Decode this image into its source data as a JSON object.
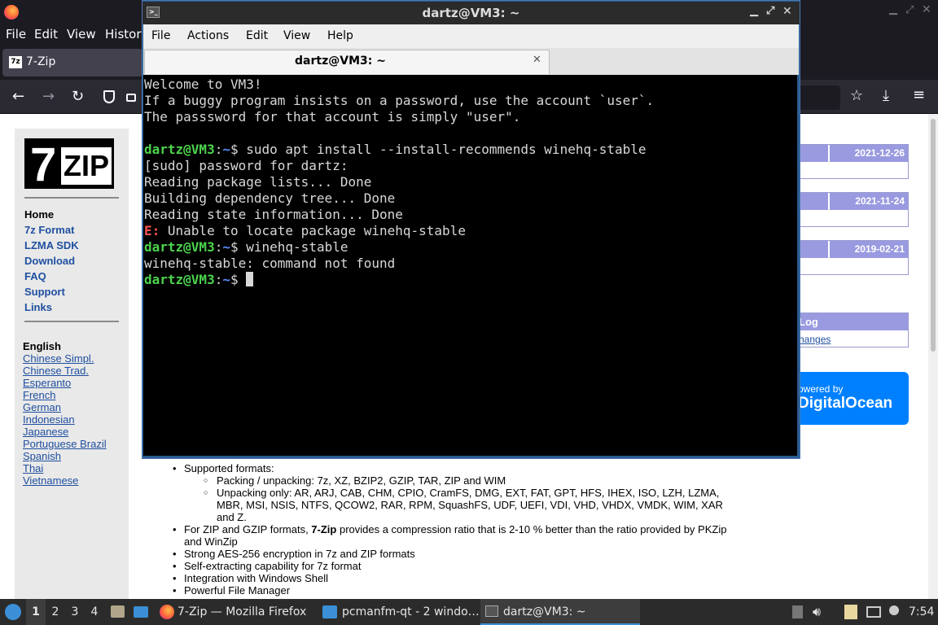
{
  "firefox": {
    "menu": [
      "File",
      "Edit",
      "View",
      "History"
    ],
    "tab_title": "7-Zip",
    "tab_icon_text": "7z"
  },
  "website": {
    "logo": {
      "seven": "7",
      "zip": "ZIP"
    },
    "nav": [
      "Home",
      "7z Format",
      "LZMA SDK",
      "Download",
      "FAQ",
      "Support",
      "Links"
    ],
    "language_heading": "English",
    "languages": [
      "Chinese Simpl.",
      "Chinese Trad.",
      "Esperanto",
      "French",
      "German",
      "Indonesian",
      "Japanese",
      "Portuguese Brazil",
      "Spanish",
      "Thai",
      "Vietnamese"
    ],
    "news_dates": [
      "2021-12-26",
      "2021-11-24",
      "2019-02-21"
    ],
    "log_heading": "Log",
    "log_link": "hanges",
    "sponsor_line1": "owered by",
    "sponsor_line2": "DigitalOcean",
    "features": {
      "supported_formats": "Supported formats:",
      "packing": "Packing / unpacking: 7z, XZ, BZIP2, GZIP, TAR, ZIP and WIM",
      "unpacking": "Unpacking only: AR, ARJ, CAB, CHM, CPIO, CramFS, DMG, EXT, FAT, GPT, HFS, IHEX, ISO, LZH, LZMA, MBR, MSI, NSIS, NTFS, QCOW2, RAR, RPM, SquashFS, UDF, UEFI, VDI, VHD, VHDX, VMDK, WIM, XAR and Z.",
      "ratio_pre": "For ZIP and GZIP formats, ",
      "ratio_bold": "7-Zip",
      "ratio_post": " provides a compression ratio that is 2-10 % better than the ratio provided by PKZip and WinZip",
      "aes": "Strong AES-256 encryption in 7z and ZIP formats",
      "sfx": "Self-extracting capability for 7z format",
      "shell": "Integration with Windows Shell",
      "fm": "Powerful File Manager"
    }
  },
  "terminal": {
    "title": "dartz@VM3: ~",
    "menu": [
      "File",
      "Actions",
      "Edit",
      "View",
      "Help"
    ],
    "tab_title": "dartz@VM3: ~",
    "prompt_user": "dartz@VM3",
    "prompt_sep": ":",
    "prompt_path": "~",
    "prompt_dollar": "$ ",
    "motd1": "Welcome to VM3!",
    "motd2": "If a buggy program insists on a password, use the account `user`.",
    "motd3": "The passsword for that account is simply \"user\".",
    "cmd1": "sudo apt install --install-recommends winehq-stable",
    "out_sudo": "[sudo] password for dartz:",
    "out_lists": "Reading package lists... Done",
    "out_tree": "Building dependency tree... Done",
    "out_state": "Reading state information... Done",
    "err_tag": "E:",
    "err_msg": " Unable to locate package winehq-stable",
    "cmd2": "winehq-stable",
    "out_notfound": "winehq-stable: command not found"
  },
  "taskbar": {
    "desktops": [
      "1",
      "2",
      "3",
      "4"
    ],
    "firefox_task": "7-Zip — Mozilla Firefox",
    "pcmanfm_task": "pcmanfm-qt - 2 windo…",
    "terminal_task": "dartz@VM3: ~",
    "clock": "7:54"
  }
}
